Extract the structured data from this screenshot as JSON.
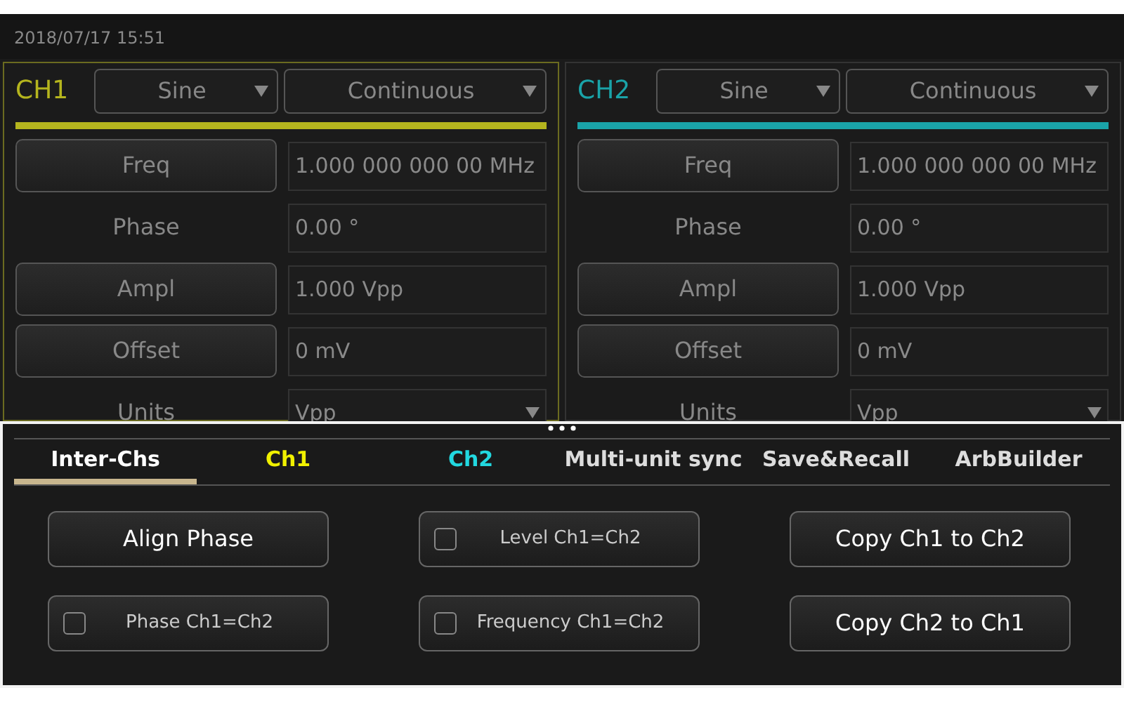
{
  "status_bar": {
    "datetime": "2018/07/17 15:51"
  },
  "channels": [
    {
      "name": "CH1",
      "color": "#b5b51e",
      "selected": true,
      "waveform": "Sine",
      "mode": "Continuous",
      "rows": [
        {
          "kind": "button",
          "label": "Freq",
          "value": "1.000 000 000 00 MHz"
        },
        {
          "kind": "label",
          "label": "Phase",
          "value": "0.00 °"
        },
        {
          "kind": "button",
          "label": "Ampl",
          "value": "1.000 Vpp"
        },
        {
          "kind": "button",
          "label": "Offset",
          "value": "0 mV"
        },
        {
          "kind": "select",
          "label": "Units",
          "value": "Vpp"
        }
      ]
    },
    {
      "name": "CH2",
      "color": "#1aa3a8",
      "selected": false,
      "waveform": "Sine",
      "mode": "Continuous",
      "rows": [
        {
          "kind": "button",
          "label": "Freq",
          "value": "1.000 000 000 00 MHz"
        },
        {
          "kind": "label",
          "label": "Phase",
          "value": "0.00 °"
        },
        {
          "kind": "button",
          "label": "Ampl",
          "value": "1.000 Vpp"
        },
        {
          "kind": "button",
          "label": "Offset",
          "value": "0 mV"
        },
        {
          "kind": "select",
          "label": "Units",
          "value": "Vpp"
        }
      ]
    }
  ],
  "drawer": {
    "tabs": [
      {
        "label": "Inter-Chs",
        "selected": true,
        "color": "#ffffff"
      },
      {
        "label": "Ch1",
        "selected": false,
        "color": "#f0f000"
      },
      {
        "label": "Ch2",
        "selected": false,
        "color": "#22d8e0"
      },
      {
        "label": "Multi-unit sync",
        "selected": false,
        "color": "#dddddd"
      },
      {
        "label": "Save&Recall",
        "selected": false,
        "color": "#dddddd"
      },
      {
        "label": "ArbBuilder",
        "selected": false,
        "color": "#dddddd"
      }
    ],
    "controls": [
      {
        "kind": "button",
        "label": "Align Phase"
      },
      {
        "kind": "checkbox",
        "label": "Level Ch1=Ch2",
        "checked": false
      },
      {
        "kind": "button",
        "label": "Copy Ch1 to Ch2"
      },
      {
        "kind": "checkbox",
        "label": "Phase Ch1=Ch2",
        "checked": false
      },
      {
        "kind": "checkbox",
        "label": "Frequency Ch1=Ch2",
        "checked": false
      },
      {
        "kind": "button",
        "label": "Copy Ch2 to Ch1"
      }
    ]
  }
}
